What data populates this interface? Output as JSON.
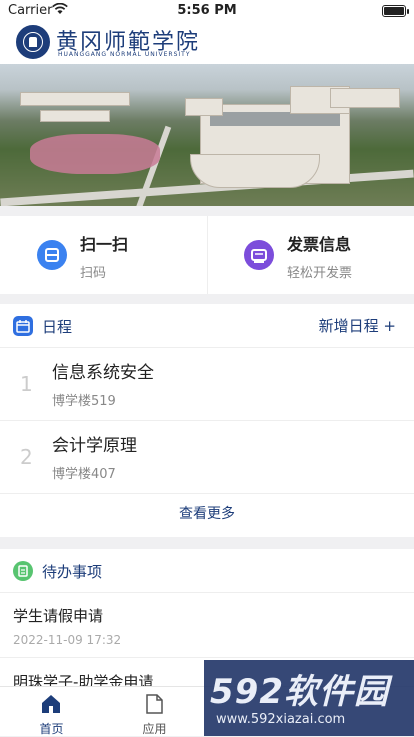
{
  "status_bar": {
    "carrier": "Carrier",
    "time": "5:56 PM"
  },
  "header": {
    "university_name": "黄冈师範学院",
    "university_name_en": "HUANGGANG NORMAL UNIVERSITY"
  },
  "quick_actions": [
    {
      "title": "扫一扫",
      "subtitle": "扫码",
      "icon": "scan-icon",
      "color": "#3b82f0"
    },
    {
      "title": "发票信息",
      "subtitle": "轻松开发票",
      "icon": "invoice-icon",
      "color": "#7c4ddb"
    }
  ],
  "schedule": {
    "title": "日程",
    "add_label": "新增日程 +",
    "items": [
      {
        "index": "1",
        "course": "信息系统安全",
        "location": "博学楼519"
      },
      {
        "index": "2",
        "course": "会计学原理",
        "location": "博学楼407"
      }
    ],
    "more_label": "查看更多"
  },
  "todo": {
    "title": "待办事项",
    "items": [
      {
        "title": "学生请假申请",
        "date": "2022-11-09 17:32"
      },
      {
        "title": "明珠学子-助学金申请",
        "date": ""
      }
    ]
  },
  "tabbar": [
    {
      "label": "首页",
      "icon": "home-icon",
      "active": true
    },
    {
      "label": "应用",
      "icon": "apps-icon",
      "active": false
    }
  ],
  "watermark": {
    "brand": "592软件园",
    "url": "www.592xiazai.com"
  },
  "colors": {
    "primary": "#1d3d7a",
    "scan": "#3b82f0",
    "invoice": "#7c4ddb",
    "schedule_icon": "#2f6fe0",
    "todo_icon": "#58c470"
  }
}
